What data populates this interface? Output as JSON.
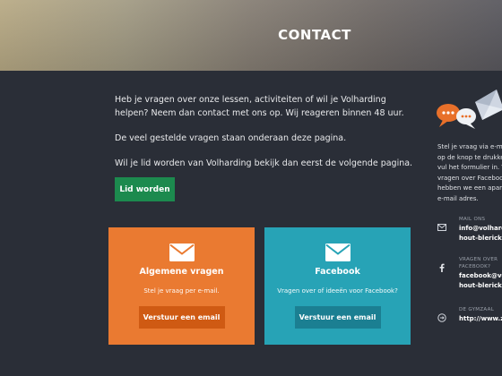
{
  "hero": {
    "title": "CONTACT"
  },
  "intro": {
    "p1": "Heb je vragen over onze lessen, activiteiten of wil je Volharding helpen? Neem dan contact met ons op. Wij reageren binnen 48 uur.",
    "p2": "De veel gestelde vragen staan onderaan deze pagina.",
    "p3": "Wil je lid worden van Volharding bekijk dan eerst de volgende pagina."
  },
  "join_button": "Lid worden",
  "cards": [
    {
      "title": "Algemene vragen",
      "subtitle": "Stel je vraag per e-mail.",
      "button": "Verstuur een email",
      "color": "#ea7a31",
      "icon": "envelope-icon"
    },
    {
      "title": "Facebook",
      "subtitle": "Vragen over of ideeën voor Facebook?",
      "button": "Verstuur een email",
      "color": "#27a3b6",
      "icon": "envelope-icon"
    }
  ],
  "sidebar": {
    "text": "Stel je vraag via e-ma\nop de knop te drukke\nvul het formulier in. V\nvragen over Faceboo\nhebben we een apart\ne-mail adres.",
    "items": [
      {
        "icon": "envelope-icon",
        "label": "MAIL ONS",
        "value": "info@volhard\nhout-blerick."
      },
      {
        "icon": "facebook-icon",
        "label": "VRAGEN OVER\nFACEBOOK?",
        "value": "facebook@vo\nhout-blerick."
      },
      {
        "icon": "globe-icon",
        "label": "DE GYMZAAL",
        "value": "http://www.z"
      }
    ]
  },
  "colors": {
    "background": "#2a2e37",
    "join_green": "#1c8a4e",
    "orange": "#ea7a31",
    "teal": "#27a3b6"
  }
}
